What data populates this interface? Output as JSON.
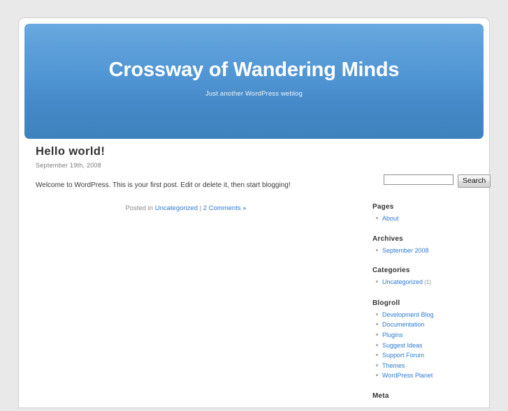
{
  "site": {
    "title": "Crossway of Wandering Minds",
    "tagline": "Just another WordPress weblog"
  },
  "post": {
    "title": "Hello world!",
    "date": "September 19th, 2008",
    "body": "Welcome to WordPress. This is your first post. Edit or delete it, then start blogging!",
    "meta_prefix": "Posted in ",
    "category": "Uncategorized",
    "meta_separator": " | ",
    "comments": "2 Comments »"
  },
  "search": {
    "value": "",
    "placeholder": "",
    "button_label": "Search"
  },
  "sidebar": {
    "widgets": [
      {
        "title": "Pages",
        "items": [
          {
            "label": "About",
            "count": ""
          }
        ]
      },
      {
        "title": "Archives",
        "items": [
          {
            "label": "September 2008",
            "count": ""
          }
        ]
      },
      {
        "title": "Categories",
        "items": [
          {
            "label": "Uncategorized",
            "count": "(1)"
          }
        ]
      },
      {
        "title": "Blogroll",
        "items": [
          {
            "label": "Development Blog",
            "count": ""
          },
          {
            "label": "Documentation",
            "count": ""
          },
          {
            "label": "Plugins",
            "count": ""
          },
          {
            "label": "Suggest Ideas",
            "count": ""
          },
          {
            "label": "Support Forum",
            "count": ""
          },
          {
            "label": "Themes",
            "count": ""
          },
          {
            "label": "WordPress Planet",
            "count": ""
          }
        ]
      },
      {
        "title": "Meta",
        "items": []
      }
    ]
  },
  "colors": {
    "link": "#2d7bd0",
    "header_top": "#6aa9e0",
    "header_bottom": "#3e82bd",
    "page_bg": "#e9e9e9"
  }
}
